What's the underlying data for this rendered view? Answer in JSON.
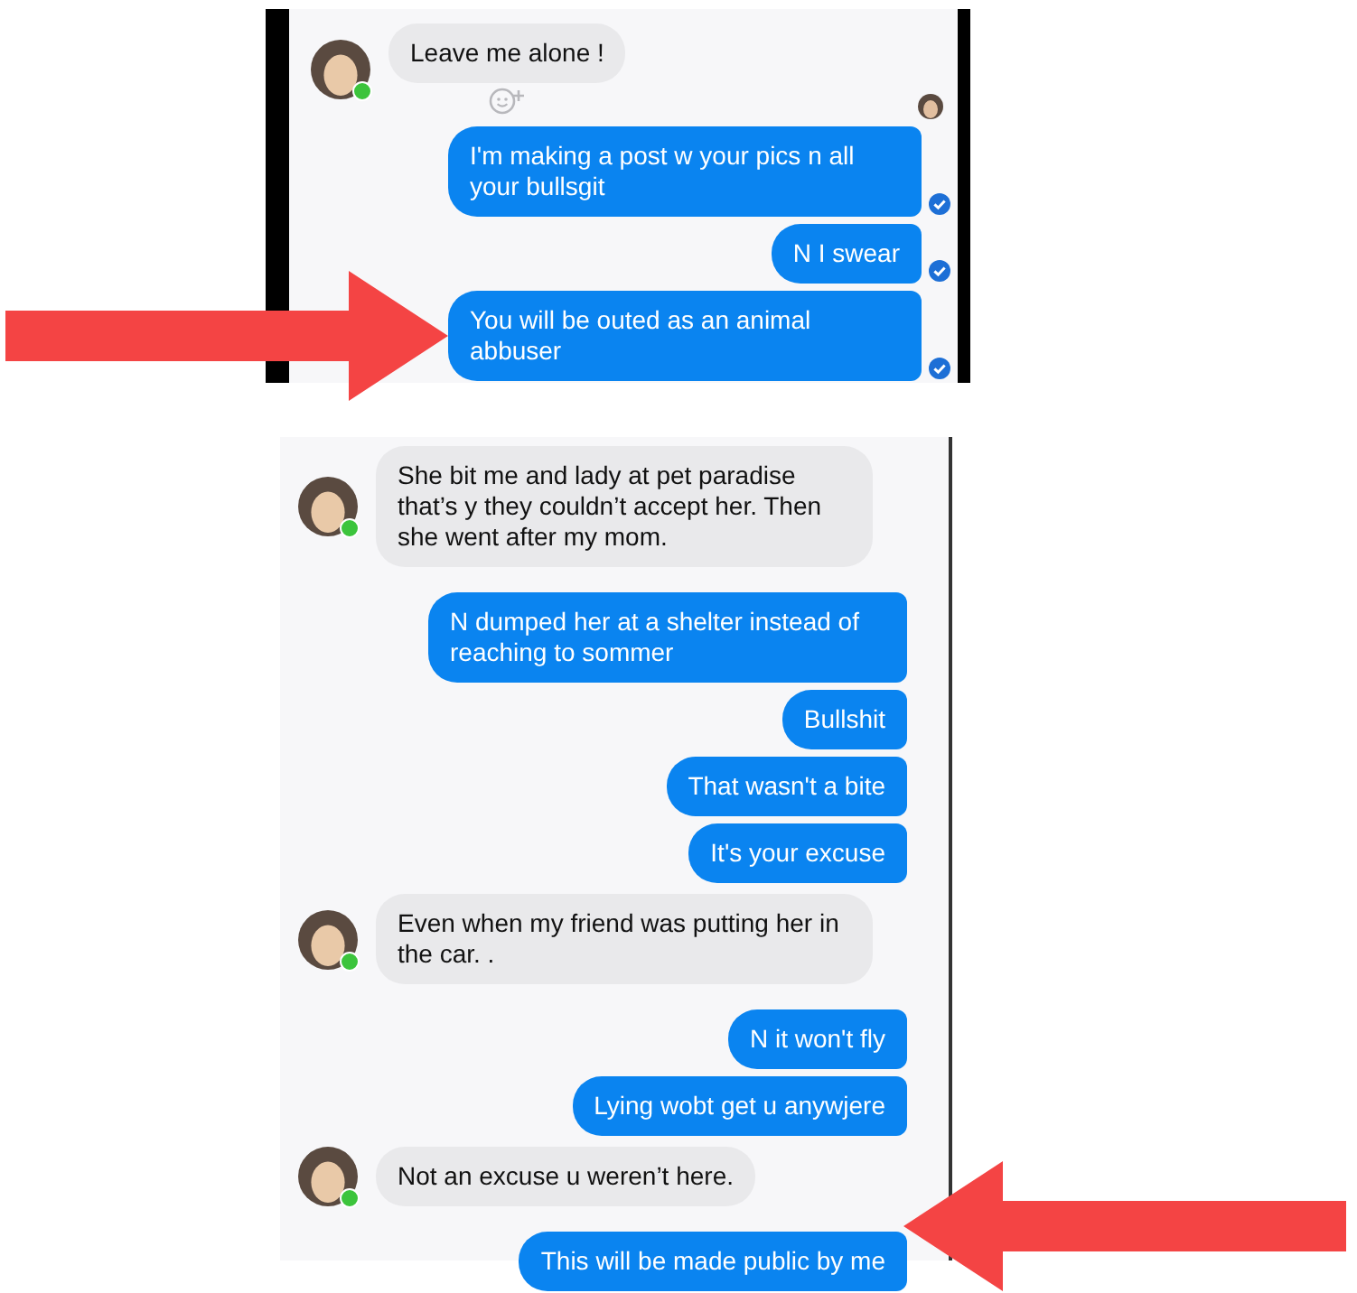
{
  "panels": [
    {
      "messages": [
        {
          "kind": "received",
          "text": "Leave me alone !",
          "online": true,
          "reaction_button": true
        },
        {
          "kind": "read_receipt"
        },
        {
          "kind": "sent",
          "text": "I'm making a post w your pics n all your bullsgit",
          "delivered": true
        },
        {
          "kind": "sent",
          "text": "N I swear",
          "delivered": true
        },
        {
          "kind": "sent",
          "text": "You will be outed as an animal abbuser",
          "delivered": true
        }
      ]
    },
    {
      "messages": [
        {
          "kind": "received",
          "text": "She bit me and lady at pet paradise that’s y they couldn’t accept her. Then she went after my mom.",
          "online": true
        },
        {
          "kind": "sent",
          "text": "N dumped her at a shelter instead of reaching to sommer"
        },
        {
          "kind": "sent",
          "text": "Bullshit"
        },
        {
          "kind": "sent",
          "text": "That wasn't a bite"
        },
        {
          "kind": "sent",
          "text": "It's your excuse"
        },
        {
          "kind": "received",
          "text": "Even when my friend was putting her in the car. .",
          "online": true
        },
        {
          "kind": "sent",
          "text": "N it won't fly"
        },
        {
          "kind": "sent",
          "text": "Lying wobt get u anywjere"
        },
        {
          "kind": "received",
          "text": "Not an excuse u weren’t here.",
          "online": true
        },
        {
          "kind": "sent",
          "text": "This will be made public by me"
        }
      ]
    }
  ]
}
